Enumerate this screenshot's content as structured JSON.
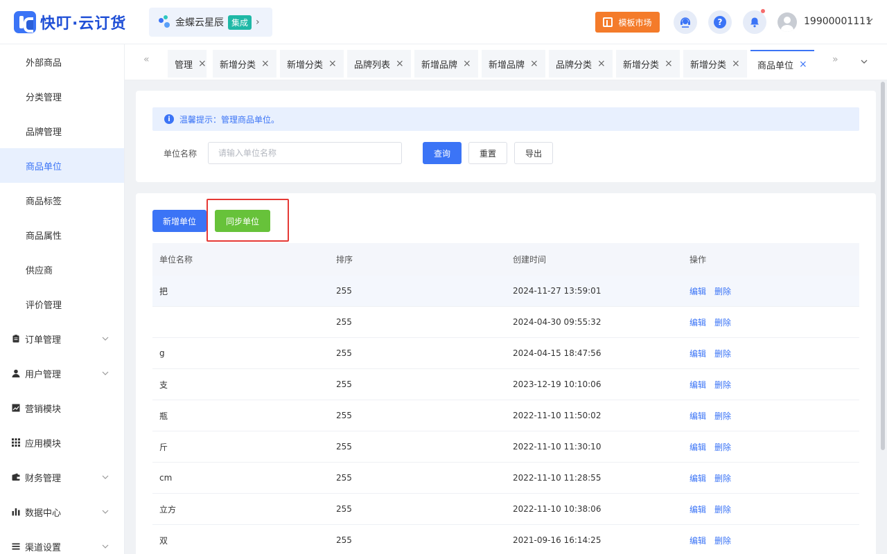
{
  "header": {
    "logo_text": "快叮·云订货",
    "integration": {
      "name": "金蝶云星辰",
      "badge": "集成",
      "arrow": "›"
    },
    "market_label": "模板市场",
    "help_glyph": "?",
    "user_name": "19900001111"
  },
  "sidebar": {
    "items": [
      {
        "label": "外部商品"
      },
      {
        "label": "分类管理"
      },
      {
        "label": "品牌管理"
      },
      {
        "label": "商品单位",
        "active": true
      },
      {
        "label": "商品标签"
      },
      {
        "label": "商品属性"
      },
      {
        "label": "供应商"
      },
      {
        "label": "评价管理"
      }
    ],
    "groups": [
      {
        "label": "订单管理",
        "icon": "clipboard-icon"
      },
      {
        "label": "用户管理",
        "icon": "user-icon"
      },
      {
        "label": "营销模块",
        "icon": "trend-chart-icon"
      },
      {
        "label": "应用模块",
        "icon": "grid-icon"
      },
      {
        "label": "财务管理",
        "icon": "wallet-icon"
      },
      {
        "label": "数据中心",
        "icon": "bar-chart-icon"
      },
      {
        "label": "渠道设置",
        "icon": "list-icon"
      }
    ]
  },
  "tabs": {
    "prev_glyph": "«",
    "next_glyph": "»",
    "items": [
      {
        "label": "管理"
      },
      {
        "label": "新增分类"
      },
      {
        "label": "新增分类"
      },
      {
        "label": "品牌列表"
      },
      {
        "label": "新增品牌"
      },
      {
        "label": "新增品牌"
      },
      {
        "label": "品牌分类"
      },
      {
        "label": "新增分类"
      },
      {
        "label": "新增分类"
      },
      {
        "label": "商品单位",
        "active": true
      }
    ],
    "close_glyph": "×"
  },
  "search": {
    "tip": "温馨提示：管理商品单位。",
    "tip_icon": "i",
    "field_label": "单位名称",
    "placeholder": "请输入单位名称",
    "query_label": "查询",
    "reset_label": "重置",
    "export_label": "导出"
  },
  "actions": {
    "add_label": "新增单位",
    "sync_label": "同步单位"
  },
  "table": {
    "columns": [
      "单位名称",
      "排序",
      "创建时间",
      "操作"
    ],
    "edit_label": "编辑",
    "delete_label": "删除",
    "rows": [
      {
        "name": "把",
        "sort": "255",
        "created": "2024-11-27 13:59:01"
      },
      {
        "name": "",
        "sort": "255",
        "created": "2024-04-30 09:55:32"
      },
      {
        "name": "g",
        "sort": "255",
        "created": "2024-04-15 18:47:56"
      },
      {
        "name": "支",
        "sort": "255",
        "created": "2023-12-19 10:10:06"
      },
      {
        "name": "瓶",
        "sort": "255",
        "created": "2022-11-10 11:50:02"
      },
      {
        "name": "斤",
        "sort": "255",
        "created": "2022-11-10 11:30:10"
      },
      {
        "name": "cm",
        "sort": "255",
        "created": "2022-11-10 11:28:55"
      },
      {
        "name": "立方",
        "sort": "255",
        "created": "2022-11-10 10:38:06"
      },
      {
        "name": "双",
        "sort": "255",
        "created": "2021-09-16 16:14:25"
      }
    ]
  },
  "colors": {
    "primary": "#3b74f6",
    "success": "#67c23a",
    "market": "#f47b2a",
    "badge": "#1fb8a6",
    "highlight": "#e53935"
  }
}
